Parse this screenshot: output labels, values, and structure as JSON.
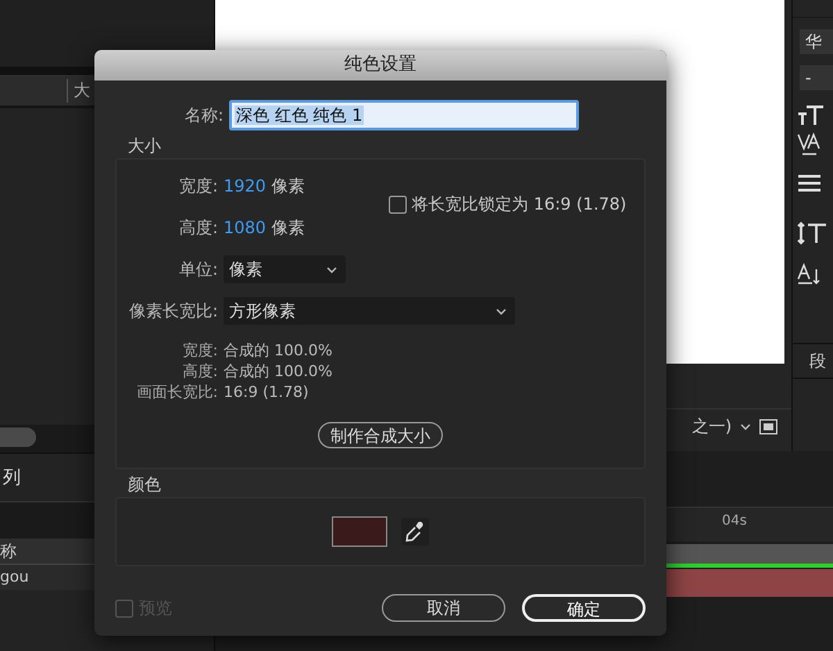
{
  "background": {
    "left_panel": {
      "tab": "大",
      "section": "列",
      "column_header": "称",
      "row": "gou"
    },
    "viewer": {
      "zoom_menu": "之一)"
    },
    "character_panel": {
      "font": "华",
      "style": "-",
      "paragraph_tab": "段"
    },
    "timeline": {
      "ruler_label": "04s"
    }
  },
  "dialog": {
    "title": "纯色设置",
    "name": {
      "label": "名称:",
      "value": "深色 红色 纯色 1"
    },
    "size": {
      "title": "大小",
      "width": {
        "label": "宽度:",
        "value": "1920",
        "unit": "像素"
      },
      "height": {
        "label": "高度:",
        "value": "1080",
        "unit": "像素"
      },
      "lock_aspect": {
        "label": "将长宽比锁定为 16:9 (1.78)",
        "checked": false
      },
      "units": {
        "label": "单位:",
        "value": "像素"
      },
      "pixel_aspect": {
        "label": "像素长宽比:",
        "value": "方形像素"
      },
      "info": [
        {
          "label": "宽度:",
          "value": "合成的 100.0%"
        },
        {
          "label": "高度:",
          "value": "合成的 100.0%"
        },
        {
          "label": "画面长宽比:",
          "value": "16:9 (1.78)"
        }
      ],
      "button": "制作合成大小"
    },
    "color": {
      "title": "颜色",
      "swatch": {
        "color": "#3b1a1c"
      }
    },
    "preview": {
      "label": "预览",
      "checked": false,
      "disabled": true
    },
    "buttons": [
      {
        "label": "取消",
        "default": false
      },
      {
        "label": "确定",
        "default": true
      }
    ]
  }
}
